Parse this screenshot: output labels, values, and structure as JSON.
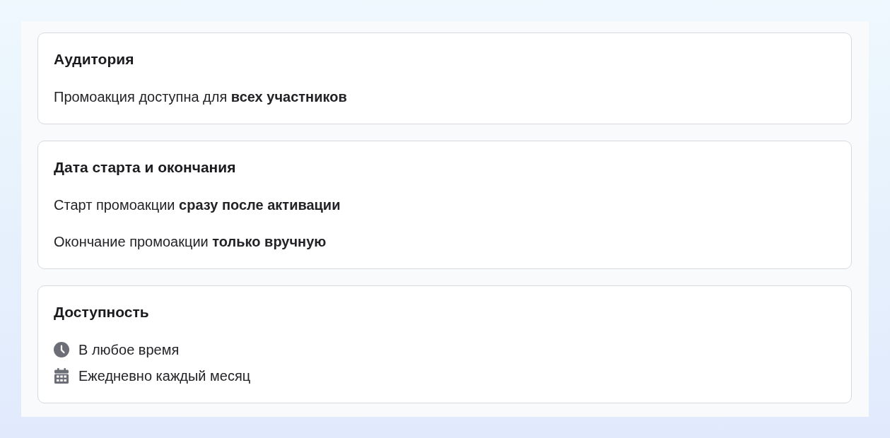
{
  "sections": [
    {
      "title": "Аудитория",
      "lines": [
        "Промоакция доступна для **всех участников**"
      ]
    },
    {
      "title": "Дата старта и окончания",
      "lines": [
        "Старт промоакции **сразу после активации**",
        "Окончание промоакции **только вручную**"
      ]
    },
    {
      "title": "Доступность",
      "items": [
        {
          "kind": "time",
          "text": "В любое время"
        },
        {
          "kind": "date",
          "text": "Ежедневно каждый месяц"
        }
      ]
    }
  ]
}
